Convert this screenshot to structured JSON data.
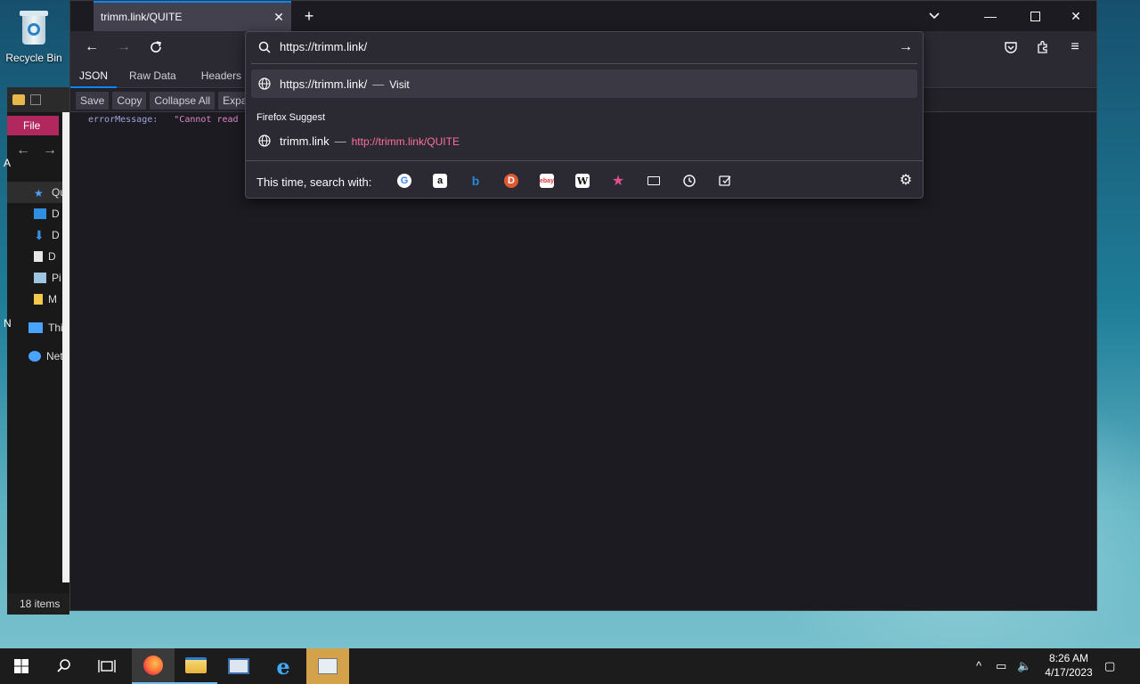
{
  "desktop": {
    "recycle_bin_label": "Recycle Bin"
  },
  "explorer": {
    "file_tab": "File",
    "tree": [
      {
        "label": "Qui",
        "icon": "star-icon"
      },
      {
        "label": "D",
        "icon": "desktop-icon"
      },
      {
        "label": "D",
        "icon": "download-icon"
      },
      {
        "label": "D",
        "icon": "document-icon"
      },
      {
        "label": "Pi",
        "icon": "pictures-icon"
      },
      {
        "label": "M",
        "icon": "folder-icon"
      },
      {
        "label": "Thi",
        "icon": "this-pc-icon"
      },
      {
        "label": "Net",
        "icon": "network-icon"
      }
    ],
    "status": "18 items",
    "side_letters": [
      "A",
      "N"
    ]
  },
  "browser": {
    "tab_title": "trimm.link/QUITE",
    "json_tabs": [
      "JSON",
      "Raw Data",
      "Headers"
    ],
    "json_toolbar": [
      "Save",
      "Copy",
      "Collapse All",
      "Expand All"
    ],
    "json_key": "errorMessage:",
    "json_value": "\"Cannot read"
  },
  "urlbar": {
    "value": "https://trimm.link/",
    "suggestions": [
      {
        "title": "https://trimm.link/",
        "separator": "—",
        "action": "Visit"
      }
    ],
    "group_label": "Firefox Suggest",
    "firefox_suggest": [
      {
        "title": "trimm.link",
        "separator": "—",
        "url": "http://trimm.link/QUITE"
      }
    ],
    "search_with_label": "This time, search with:",
    "engines": [
      "google-icon",
      "amazon-icon",
      "bing-icon",
      "duckduckgo-icon",
      "ebay-icon",
      "wikipedia-icon",
      "bookmarks-icon",
      "tabs-icon",
      "history-icon",
      "actions-icon"
    ]
  },
  "taskbar": {
    "time": "8:26 AM",
    "date": "4/17/2023"
  },
  "colors": {
    "accent": "#0a84ff",
    "link_pink": "#ff6f9c",
    "file_tab": "#b0285e"
  }
}
